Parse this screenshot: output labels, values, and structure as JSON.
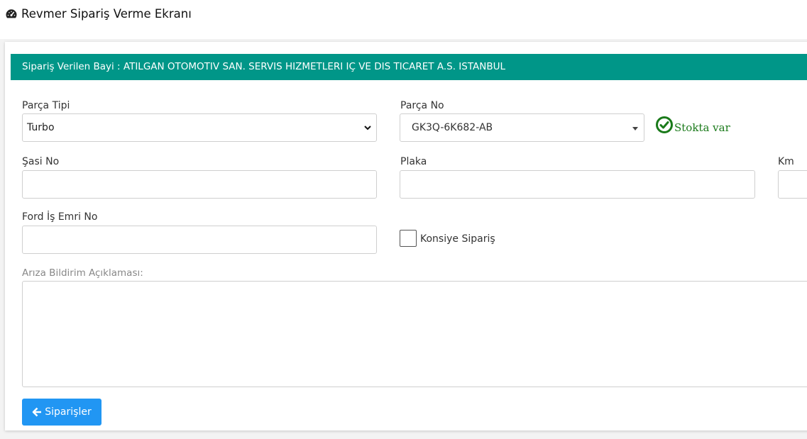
{
  "page": {
    "title": "Revmer Sipariş Verme Ekranı",
    "title_icon": "dashboard-icon"
  },
  "dealer_bar": {
    "text": "Sipariş Verilen Bayi : ATILGAN OTOMOTIV SAN. SERVIS HIZMETLERI IÇ VE DIS TICARET A.S. ISTANBUL"
  },
  "form": {
    "part_type": {
      "label": "Parça Tipi",
      "value": "Turbo"
    },
    "part_no": {
      "label": "Parça No",
      "value": "GK3Q-6K682-AB"
    },
    "stock": {
      "text": "Stokta var",
      "color": "#1a7a1a",
      "icon": "check-circle-icon"
    },
    "chassis_no": {
      "label": "Şasi No",
      "value": ""
    },
    "plate": {
      "label": "Plaka",
      "value": ""
    },
    "km": {
      "label": "Km",
      "value": ""
    },
    "ford_work_order": {
      "label": "Ford İş Emri No",
      "value": ""
    },
    "consignment": {
      "label": "Konsiye Sipariş",
      "checked": false
    },
    "fault_description": {
      "label": "Arıza Bildirim Açıklaması:",
      "value": ""
    }
  },
  "buttons": {
    "orders": {
      "label": "Siparişler",
      "icon": "arrow-left-icon"
    }
  },
  "colors": {
    "header_bar": "#009688",
    "primary_button": "#2196f3"
  }
}
